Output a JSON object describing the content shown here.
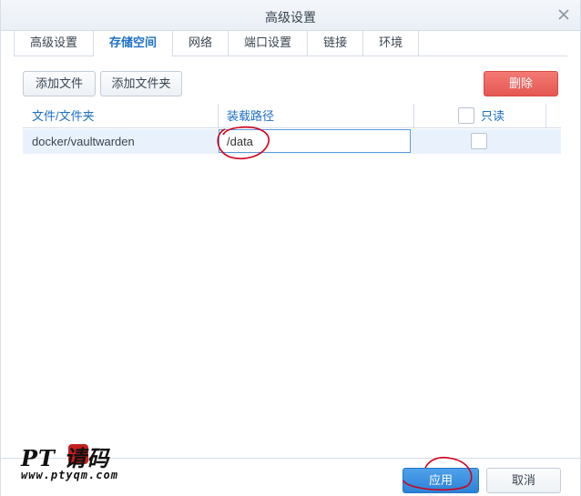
{
  "window": {
    "title": "高级设置",
    "close_icon": "close-icon"
  },
  "tabs": [
    {
      "label": "高级设置",
      "active": false
    },
    {
      "label": "存储空间",
      "active": true
    },
    {
      "label": "网络",
      "active": false
    },
    {
      "label": "端口设置",
      "active": false
    },
    {
      "label": "链接",
      "active": false
    },
    {
      "label": "环境",
      "active": false
    }
  ],
  "toolbar": {
    "add_file_label": "添加文件",
    "add_folder_label": "添加文件夹",
    "delete_label": "删除"
  },
  "grid": {
    "columns": {
      "file_folder": "文件/文件夹",
      "mount_path": "装载路径",
      "readonly": "只读"
    },
    "rows": [
      {
        "file_folder": "docker/vaultwarden",
        "mount_path": "/data",
        "readonly": false
      }
    ]
  },
  "footer": {
    "apply_label": "应用",
    "cancel_label": "取消"
  },
  "watermark": {
    "line1": "PT 请码",
    "line2": "www.ptyqm.com"
  },
  "colors": {
    "accent": "#1d6fc6",
    "delete": "#e45751",
    "apply": "#2c82d6",
    "row_highlight": "#e9f2fc",
    "annotation": "#d0021b"
  }
}
